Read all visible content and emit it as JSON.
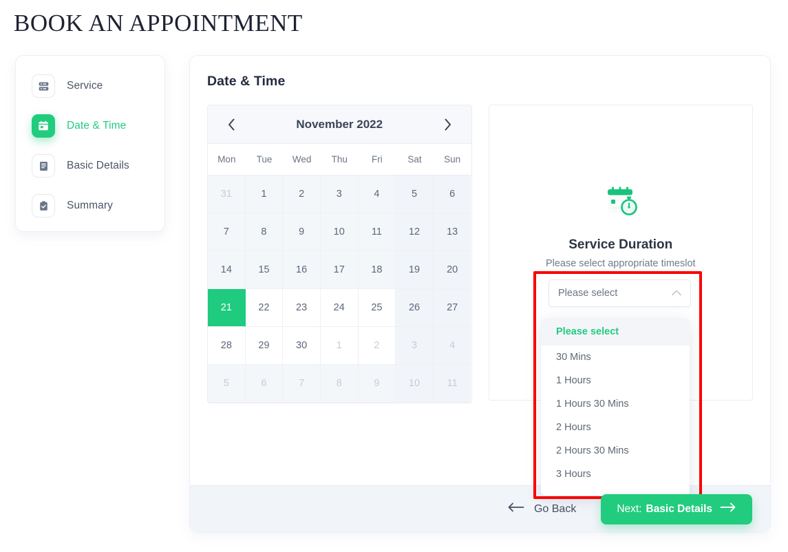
{
  "page": {
    "title": "BOOK AN APPOINTMENT"
  },
  "colors": {
    "accent_green": "#22cc7e",
    "selected_day": "#1fcb7f",
    "annotation_red": "#fb0000",
    "footer_bg": "#f1f4f9",
    "text_dark": "#232b3e",
    "text_muted": "#6b7586"
  },
  "sidebar": {
    "items": [
      {
        "label": "Service",
        "icon": "server-stack-icon",
        "active": false
      },
      {
        "label": "Date & Time",
        "icon": "calendar-icon",
        "active": true
      },
      {
        "label": "Basic Details",
        "icon": "document-lines-icon",
        "active": false
      },
      {
        "label": "Summary",
        "icon": "clipboard-check-icon",
        "active": false
      }
    ]
  },
  "main": {
    "heading": "Date & Time"
  },
  "calendar": {
    "prev_icon": "chevron-left-icon",
    "next_icon": "chevron-right-icon",
    "month_label": "November 2022",
    "weekdays": [
      "Mon",
      "Tue",
      "Wed",
      "Thu",
      "Fri",
      "Sat",
      "Sun"
    ],
    "selected_day": "21",
    "weeks": [
      [
        {
          "d": "31",
          "state": "past-muted"
        },
        {
          "d": "1",
          "state": "past"
        },
        {
          "d": "2",
          "state": "past"
        },
        {
          "d": "3",
          "state": "past"
        },
        {
          "d": "4",
          "state": "past"
        },
        {
          "d": "5",
          "state": "past-weekend"
        },
        {
          "d": "6",
          "state": "past-weekend"
        }
      ],
      [
        {
          "d": "7",
          "state": "past"
        },
        {
          "d": "8",
          "state": "past"
        },
        {
          "d": "9",
          "state": "past"
        },
        {
          "d": "10",
          "state": "past"
        },
        {
          "d": "11",
          "state": "past"
        },
        {
          "d": "12",
          "state": "past-weekend"
        },
        {
          "d": "13",
          "state": "past-weekend"
        }
      ],
      [
        {
          "d": "14",
          "state": "past"
        },
        {
          "d": "15",
          "state": "past"
        },
        {
          "d": "16",
          "state": "past"
        },
        {
          "d": "17",
          "state": "past"
        },
        {
          "d": "18",
          "state": "past"
        },
        {
          "d": "19",
          "state": "past-weekend"
        },
        {
          "d": "20",
          "state": "past-weekend"
        }
      ],
      [
        {
          "d": "21",
          "state": "selected"
        },
        {
          "d": "22",
          "state": "available"
        },
        {
          "d": "23",
          "state": "available"
        },
        {
          "d": "24",
          "state": "available"
        },
        {
          "d": "25",
          "state": "available"
        },
        {
          "d": "26",
          "state": "weekend"
        },
        {
          "d": "27",
          "state": "weekend"
        }
      ],
      [
        {
          "d": "28",
          "state": "available"
        },
        {
          "d": "29",
          "state": "available"
        },
        {
          "d": "30",
          "state": "available"
        },
        {
          "d": "1",
          "state": "outside"
        },
        {
          "d": "2",
          "state": "outside"
        },
        {
          "d": "3",
          "state": "outside-weekend"
        },
        {
          "d": "4",
          "state": "outside-weekend"
        }
      ],
      [
        {
          "d": "5",
          "state": "outside-past"
        },
        {
          "d": "6",
          "state": "outside-past"
        },
        {
          "d": "7",
          "state": "outside-past"
        },
        {
          "d": "8",
          "state": "outside-past"
        },
        {
          "d": "9",
          "state": "outside-past"
        },
        {
          "d": "10",
          "state": "outside-past-weekend"
        },
        {
          "d": "11",
          "state": "outside-past-weekend"
        }
      ]
    ]
  },
  "duration": {
    "icon": "calendar-stopwatch-icon",
    "title": "Service Duration",
    "subtitle": "Please select appropriate timeslot",
    "select": {
      "value": "Please select",
      "placeholder": "Please select",
      "chevron_icon": "chevron-up-icon",
      "expanded": true,
      "options": [
        {
          "label": "Please select",
          "highlighted": true
        },
        {
          "label": "30 Mins",
          "highlighted": false
        },
        {
          "label": "1 Hours",
          "highlighted": false
        },
        {
          "label": "1 Hours 30 Mins",
          "highlighted": false
        },
        {
          "label": "2 Hours",
          "highlighted": false
        },
        {
          "label": "2 Hours 30 Mins",
          "highlighted": false
        },
        {
          "label": "3 Hours",
          "highlighted": false
        }
      ]
    }
  },
  "footer": {
    "back_icon": "arrow-left-icon",
    "back_label": "Go Back",
    "next_prefix": "Next:",
    "next_label": "Basic Details",
    "next_icon": "arrow-right-icon"
  }
}
